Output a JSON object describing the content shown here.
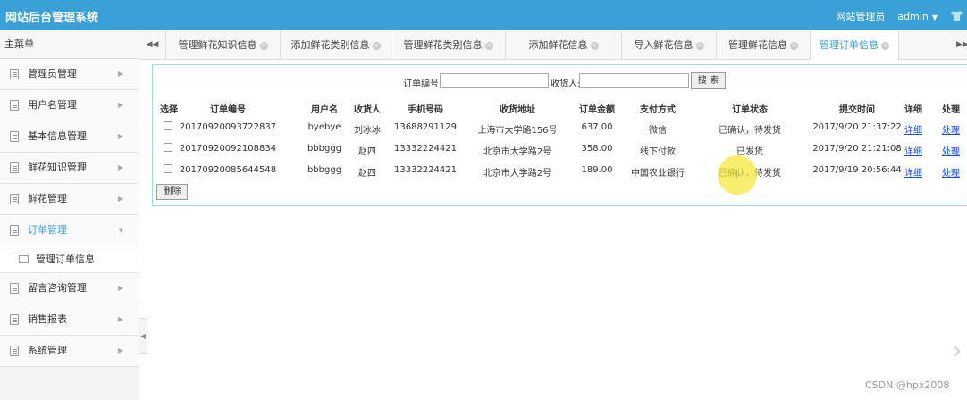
{
  "header": {
    "title": "网站后台管理系统",
    "role": "网站管理员",
    "user": "admin",
    "user_caret_icon": "caret-down-icon",
    "shirt_icon": "shirt-icon"
  },
  "sidebar": {
    "title": "主菜单",
    "items": [
      {
        "label": "管理员管理"
      },
      {
        "label": "用户名管理"
      },
      {
        "label": "基本信息管理"
      },
      {
        "label": "鲜花知识管理"
      },
      {
        "label": "鲜花管理"
      },
      {
        "label": "订单管理",
        "active": true,
        "sub": [
          {
            "label": "管理订单信息"
          }
        ]
      },
      {
        "label": "留言咨询管理"
      },
      {
        "label": "销售报表"
      },
      {
        "label": "系统管理"
      }
    ]
  },
  "tabs": [
    {
      "label": "管理鲜花知识信息"
    },
    {
      "label": "添加鲜花类别信息"
    },
    {
      "label": "管理鲜花类别信息"
    },
    {
      "label": "添加鲜花信息"
    },
    {
      "label": "导入鲜花信息"
    },
    {
      "label": "管理鲜花信息"
    },
    {
      "label": "管理订单信息",
      "active": true
    }
  ],
  "search": {
    "order_no_label": "订单编号:",
    "receiver_label": "收货人:",
    "order_no_value": "",
    "receiver_value": "",
    "button_label": "搜 索"
  },
  "table": {
    "headers": [
      "选择",
      "订单编号",
      "用户名",
      "收货人",
      "手机号码",
      "收货地址",
      "订单金额",
      "支付方式",
      "订单状态",
      "提交时间",
      "详细",
      "处理"
    ],
    "rows": [
      {
        "order_no": "20170920093722837",
        "username": "byebye",
        "receiver": "刘冰冰",
        "phone": "13688291129",
        "address": "上海市大学路156号",
        "amount": "637.00",
        "payment": "微信",
        "status": "已确认，待发货",
        "time": "2017/9/20 21:37:22",
        "detail": "详细",
        "process": "处理"
      },
      {
        "order_no": "20170920092108834",
        "username": "bbbggg",
        "receiver": "赵四",
        "phone": "13332224421",
        "address": "北京市大学路2号",
        "amount": "358.00",
        "payment": "线下付款",
        "status": "已发货",
        "time": "2017/9/20 21:21:08",
        "detail": "详细",
        "process": "处理"
      },
      {
        "order_no": "20170920085644548",
        "username": "bbbggg",
        "receiver": "赵四",
        "phone": "13332224421",
        "address": "北京市大学路2号",
        "amount": "189.00",
        "payment": "中国农业银行",
        "status": "已确认，待发货",
        "time": "2017/9/19 20:56:44",
        "detail": "详细",
        "process": "处理"
      }
    ],
    "delete_label": "删除"
  },
  "watermark": "CSDN @hpx2008",
  "colors": {
    "brand": "#3aa0d8",
    "link": "#1a4ed6",
    "panel_border": "#a6d5ee",
    "cursor_highlight": "#f4e83c"
  }
}
